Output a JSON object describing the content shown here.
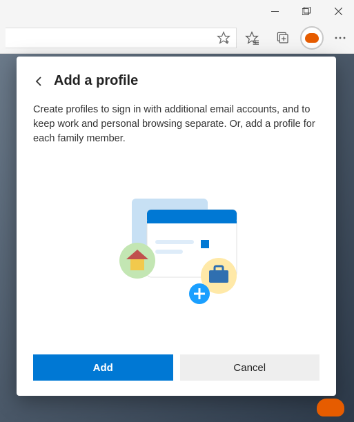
{
  "window": {
    "minimize": "—",
    "maximize": "❐",
    "close": "✕"
  },
  "toolbar": {
    "favorite_icon": "star-add-icon",
    "favorites_list_icon": "star-lines-icon",
    "collections_icon": "collections-icon",
    "profile_icon": "profile-avatar",
    "more_icon": "more-icon"
  },
  "popup": {
    "back_icon": "chevron-left-icon",
    "title": "Add a profile",
    "body": "Create profiles to sign in with additional email accounts, and to keep work and personal browsing separate. Or, add a profile for each family member.",
    "add_label": "Add",
    "cancel_label": "Cancel"
  }
}
